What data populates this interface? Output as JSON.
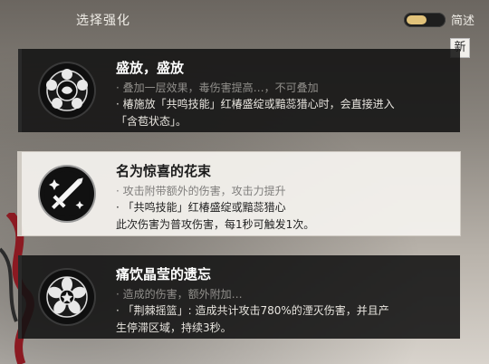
{
  "header": {
    "title": "选择强化",
    "toggle_label": "简述",
    "toggle_on": true
  },
  "new_badge": "新",
  "cards": [
    {
      "name": "盛放，盛放",
      "icon": "rose-emblem-icon",
      "desc_partial": "· 叠加一层效果，毒伤害提高…，不可叠加",
      "desc_line1": "· 椿施放「共鸣技能」红椿盛绽或黯蕊猎心时，会直接进入",
      "desc_line2": "「含苞状态」。"
    },
    {
      "name": "名为惊喜的花束",
      "icon": "sword-emblem-icon",
      "desc_partial": "· 攻击附带额外的伤害，攻击力提升",
      "desc_line1": "· 「共鸣技能」红椿盛绽或黯蕊猎心",
      "desc_line2": "此次伤害为普攻伤害，每1秒可触发1次。"
    },
    {
      "name": "痛饮晶莹的遗忘",
      "icon": "flower-emblem-icon",
      "desc_partial": "· 造成的伤害，额外附加…",
      "desc_line1": "· 「荆棘摇篮」: 造成共计攻击780%的湮灭伤害，并且产",
      "desc_line2": "生停滞区域，持续3秒。"
    }
  ],
  "colors": {
    "accent_gold": "#e1c27a",
    "card_dark": "#121212",
    "card_light": "#f4f2ee"
  }
}
